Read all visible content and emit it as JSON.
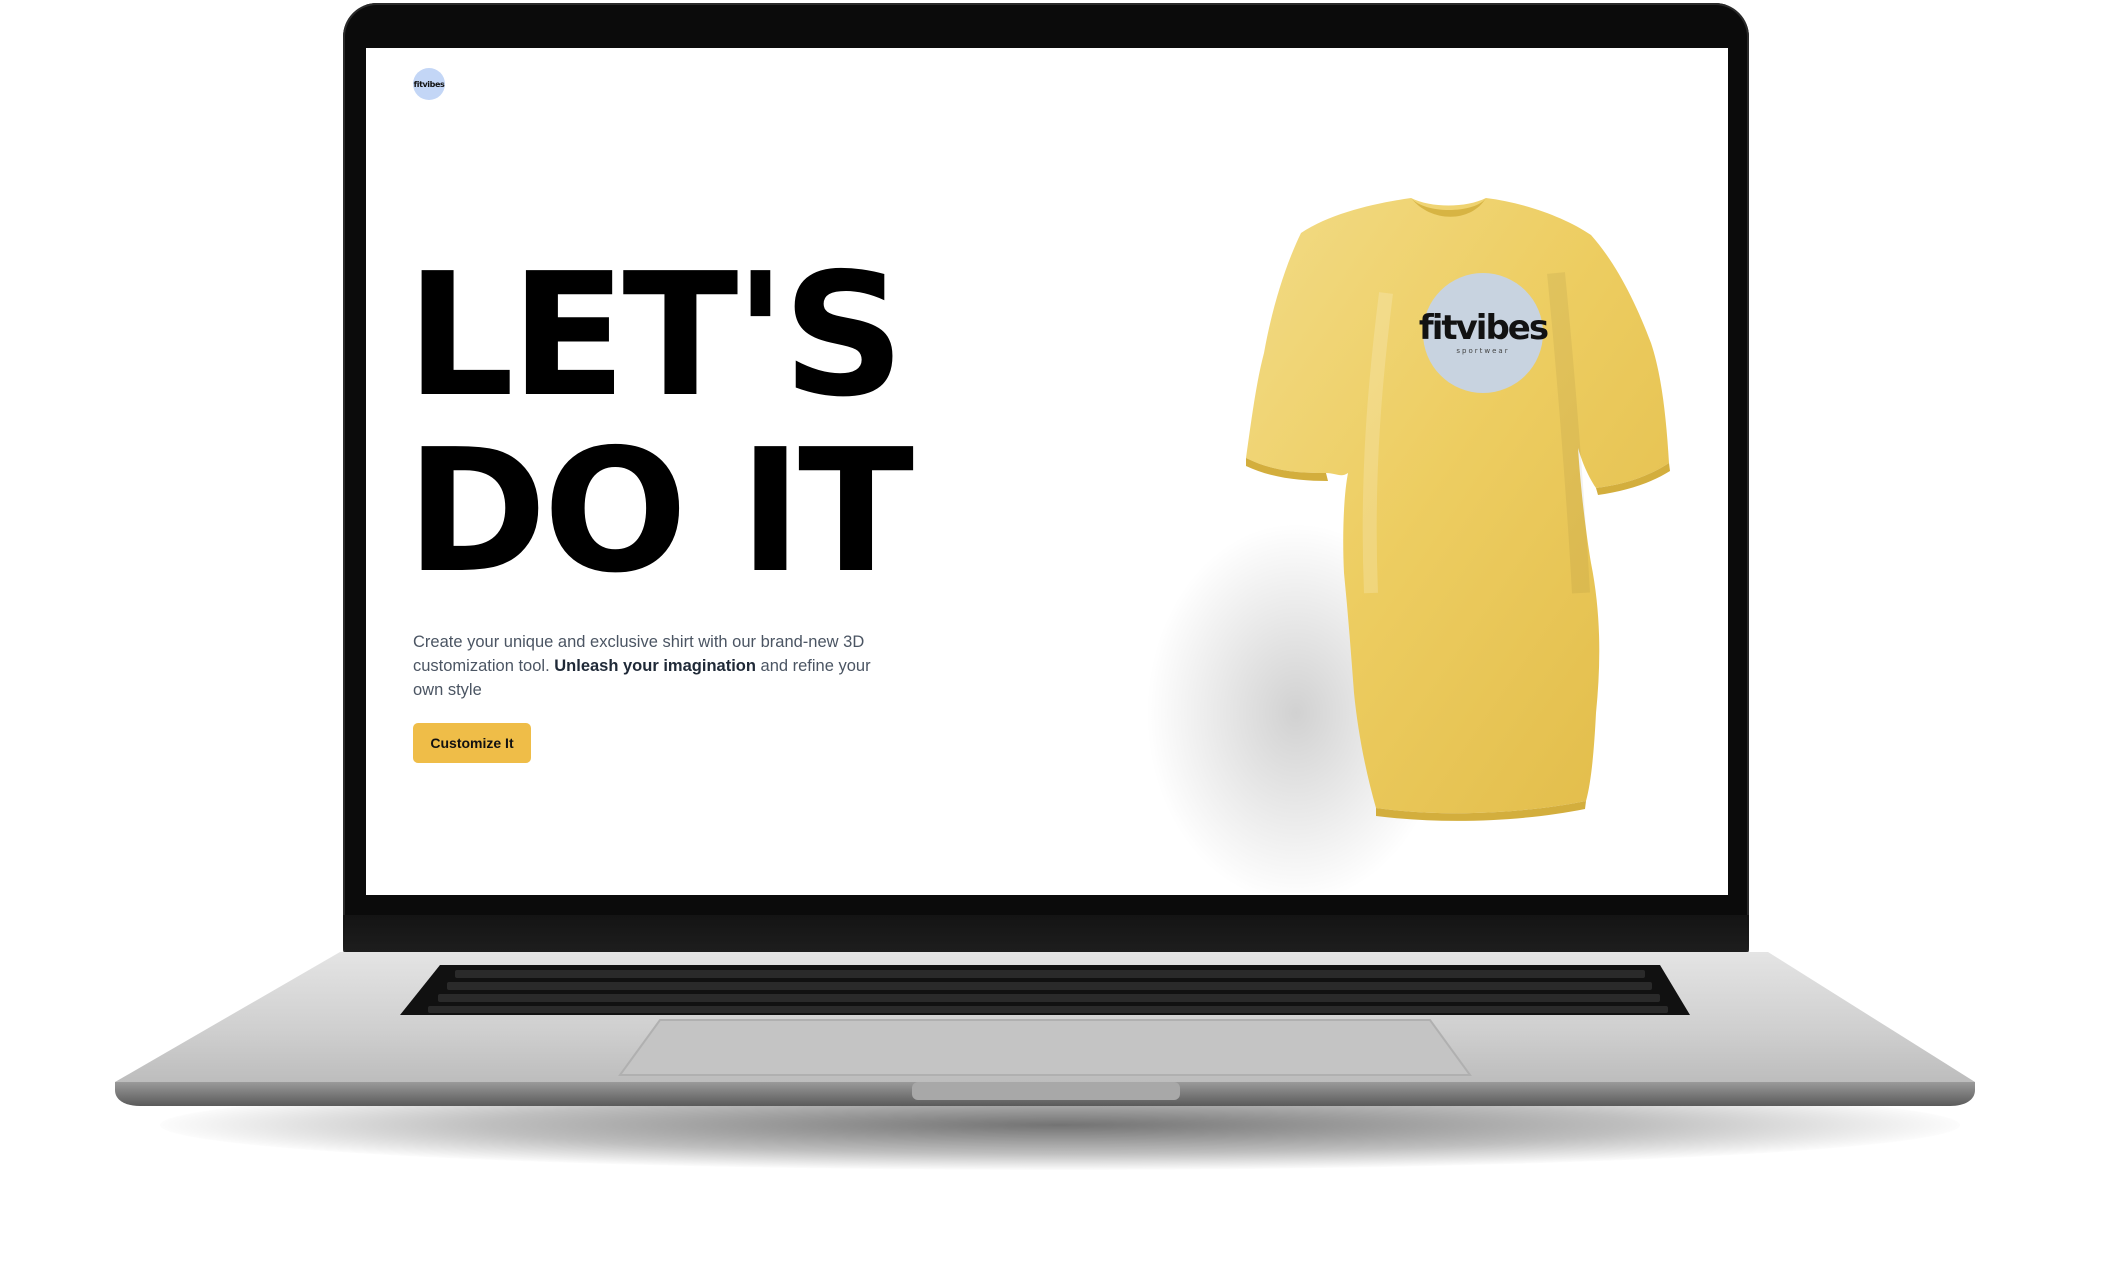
{
  "site": {
    "logo_text": "fitvibes"
  },
  "hero": {
    "headline_line1": "LET'S",
    "headline_line2": "DO IT",
    "description_part1": "Create your unique and exclusive shirt with our brand-new 3D customization tool. ",
    "description_bold": "Unleash your imagination",
    "description_part2": " and refine your own style",
    "cta_label": "Customize It"
  },
  "shirt": {
    "color": "#efcf63",
    "logo_bg_color": "#c8d3e0",
    "logo_text": "fitvibes",
    "logo_subtext": "sportwear"
  },
  "colors": {
    "accent": "#efbd48",
    "text_muted": "#4b5563",
    "headline": "#000000"
  },
  "icons": {
    "logo": "fitvibes-logo-icon"
  }
}
